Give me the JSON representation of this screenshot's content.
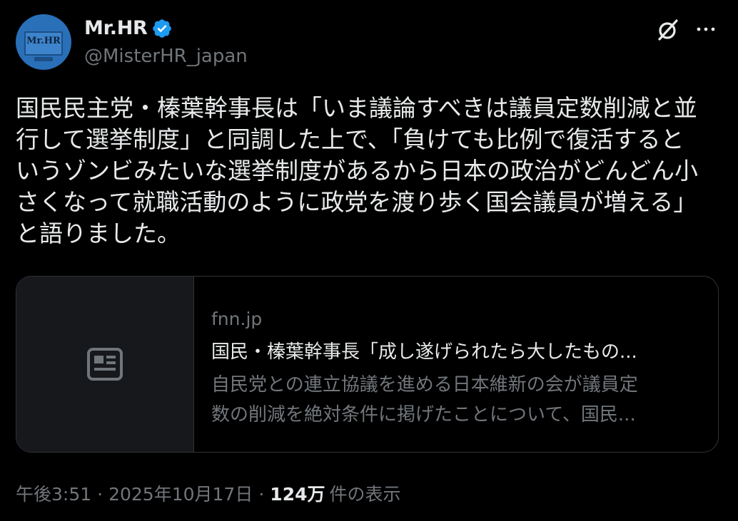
{
  "author": {
    "display_name": "Mr.HR",
    "handle": "@MisterHR_japan",
    "avatar_text": "Mr.HR",
    "verified": true
  },
  "tweet": {
    "text": "国民民主党・榛葉幹事長は「いま議論すべきは議員定数削減と並\n行して選挙制度」と同調した上で、「負けても比例で復活すると\nいうゾンビみたいな選挙制度があるから日本の政治がどんどん小\nさくなって就職活動のように政党を渡り歩く国会議員が増える」\nと語りました。"
  },
  "card": {
    "domain": "fnn.jp",
    "title": "国民・榛葉幹事長「成し遂げられたら大したもの...",
    "description": "自民党との連立協議を進める日本維新の会が議員定\n数の削減を絶対条件に掲げたことについて、国民..."
  },
  "meta": {
    "time": "午後3:51",
    "date": "2025年10月17日",
    "views_count": "124万",
    "views_label": "件の表示",
    "separator": "·"
  },
  "icons": {
    "verified": "verified-badge-icon",
    "grok": "grok-icon",
    "more": "more-icon",
    "news": "news-article-icon"
  },
  "colors": {
    "background": "#000000",
    "text_primary": "#e7e9ea",
    "text_secondary": "#71767b",
    "verified_blue": "#1d9bf0",
    "card_border": "#2f3336",
    "card_thumb_bg": "#16181c"
  }
}
